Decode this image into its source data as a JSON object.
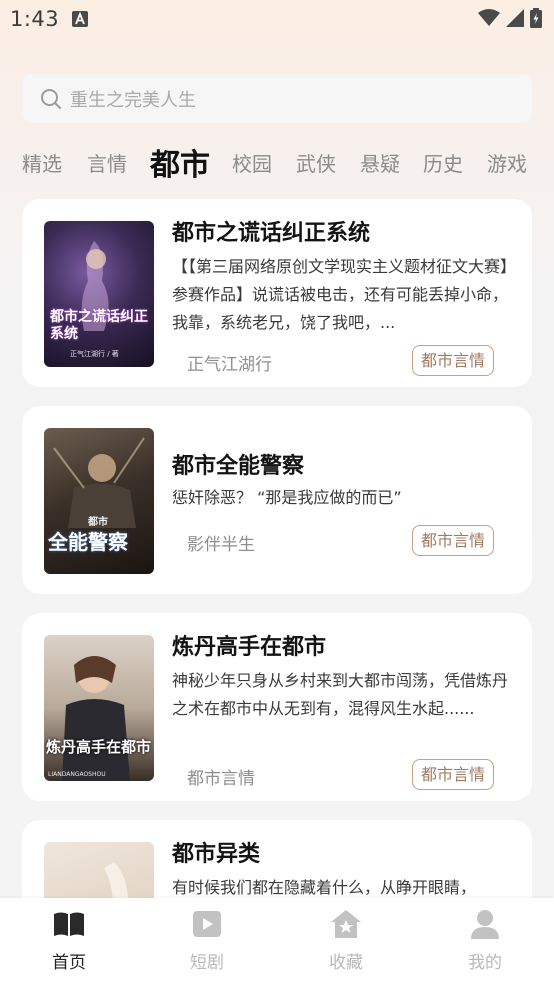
{
  "status_bar": {
    "time": "1:43"
  },
  "search": {
    "placeholder": "重生之完美人生"
  },
  "tabs": [
    {
      "label": "精选",
      "active": false
    },
    {
      "label": "言情",
      "active": false
    },
    {
      "label": "都市",
      "active": true
    },
    {
      "label": "校园",
      "active": false
    },
    {
      "label": "武侠",
      "active": false
    },
    {
      "label": "悬疑",
      "active": false
    },
    {
      "label": "历史",
      "active": false
    },
    {
      "label": "游戏",
      "active": false
    }
  ],
  "books": [
    {
      "title": "都市之谎话纠正系统",
      "description": "【【第三届网络原创文学现实主义题材征文大赛】参赛作品】说谎话被电击，还有可能丢掉小命，我靠，系统老兄，饶了我吧，...",
      "author": "正气江湖行",
      "tag": "都市言情",
      "cover_text": "都市之谎话纠正系统",
      "cover_sub": "正气江湖行 / 著"
    },
    {
      "title": "都市全能警察",
      "description": "惩奸除恶？  “那是我应做的而已”",
      "author": "影伴半生",
      "tag": "都市言情",
      "cover_text": "全能警察",
      "cover_sub": "都市"
    },
    {
      "title": "炼丹高手在都市",
      "description": "神秘少年只身从乡村来到大都市闯荡，凭借炼丹之术在都市中从无到有，混得风生水起......",
      "author": "都市言情",
      "tag": "都市言情",
      "cover_text": "炼丹高手在都市",
      "cover_sub": "LIANDANGAOSHOU"
    },
    {
      "title": "都市异类",
      "description": "有时候我们都在隐藏着什么，从睁开眼睛，",
      "author": "",
      "tag": ""
    }
  ],
  "bottom_nav": [
    {
      "label": "首页",
      "icon": "book-open-icon",
      "active": true
    },
    {
      "label": "短剧",
      "icon": "play-video-icon",
      "active": false
    },
    {
      "label": "收藏",
      "icon": "star-house-icon",
      "active": false
    },
    {
      "label": "我的",
      "icon": "user-icon",
      "active": false
    }
  ],
  "colors": {
    "accent_tag": "#a07a62",
    "active_text": "#111111",
    "inactive_text": "#8b8b8b"
  }
}
